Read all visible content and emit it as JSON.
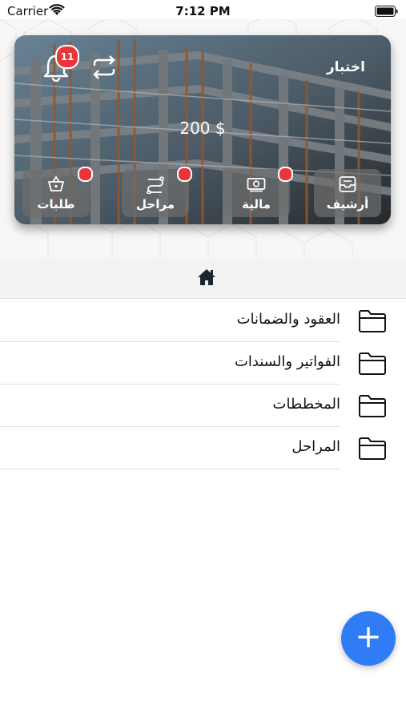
{
  "status_bar": {
    "carrier": "Carrier",
    "time": "7:12 PM"
  },
  "card": {
    "title": "اختبار",
    "balance": "200 $",
    "notification_count": "11",
    "tiles": [
      {
        "label": "أرشيف",
        "icon": "archive-tray-icon",
        "has_dot": false
      },
      {
        "label": "مالية",
        "icon": "money-icon",
        "has_dot": true
      },
      {
        "label": "مراحل",
        "icon": "stages-route-icon",
        "has_dot": true
      },
      {
        "label": "طلبات",
        "icon": "basket-icon",
        "has_dot": true
      }
    ]
  },
  "breadcrumb": {
    "icon": "home-icon"
  },
  "folders": [
    {
      "label": "العقود والضمانات",
      "icon": "folder-icon"
    },
    {
      "label": "الفواتير والسندات",
      "icon": "folder-icon"
    },
    {
      "label": "المخططات",
      "icon": "folder-icon"
    },
    {
      "label": "المراحل",
      "icon": "folder-icon"
    }
  ],
  "fab": {
    "label": "+"
  },
  "colors": {
    "accent": "#2f7cf6",
    "badge": "#e8363c"
  }
}
